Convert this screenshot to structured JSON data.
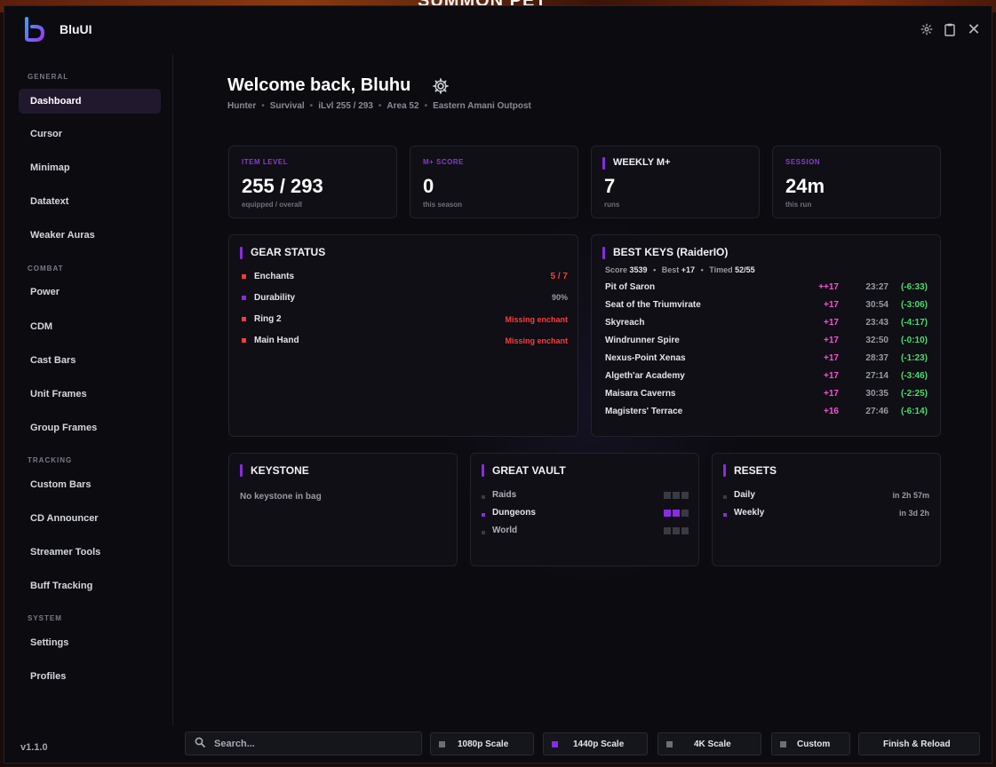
{
  "background": {
    "banner": "SUMMON PET"
  },
  "app": {
    "title": "BluUI",
    "version": "v1.1.0"
  },
  "colors": {
    "accent": "#8a2be2",
    "danger": "#ff3b3b",
    "key_level": "#ff4fd8",
    "time_under": "#4cdc6c"
  },
  "titlebar": {
    "icons": [
      "gear-icon",
      "clipboard-icon",
      "close-icon"
    ]
  },
  "sidebar": {
    "sections": {
      "general": "GENERAL",
      "combat": "COMBAT",
      "tracking": "TRACKING",
      "system": "SYSTEM"
    },
    "items": [
      "Dashboard",
      "Cursor",
      "Minimap",
      "Datatext",
      "Weaker Auras",
      "Power",
      "CDM",
      "Cast Bars",
      "Unit Frames",
      "Group Frames",
      "Custom Bars",
      "CD Announcer",
      "Streamer Tools",
      "Buff Tracking",
      "Settings",
      "Profiles"
    ],
    "active": "Dashboard"
  },
  "header": {
    "welcome": "Welcome back, Bluhu",
    "class": "Hunter",
    "spec": "Survival",
    "ilvl": "iLvl 255 / 293",
    "area": "Area 52",
    "zone": "Eastern Amani Outpost"
  },
  "stats": [
    {
      "label": "ITEM LEVEL",
      "value": "255 / 293",
      "sub": "equipped / overall"
    },
    {
      "label": "M+ SCORE",
      "value": "0",
      "sub": "this season"
    },
    {
      "label": "WEEKLY M+",
      "value": "7",
      "sub": "runs"
    },
    {
      "label": "SESSION",
      "value": "24m",
      "sub": "this run"
    }
  ],
  "gear": {
    "title": "GEAR STATUS",
    "rows": [
      {
        "name": "Enchants",
        "value": "5 / 7"
      },
      {
        "name": "Durability",
        "value": "90%"
      },
      {
        "name": "Ring 2",
        "value": "Missing enchant"
      },
      {
        "name": "Main Hand",
        "value": "Missing enchant"
      }
    ]
  },
  "keys": {
    "title": "BEST KEYS (RaiderIO)",
    "score_label": "Score",
    "score": "3539",
    "best_label": "Best",
    "best": "+17",
    "timed_label": "Timed",
    "timed": "52/55",
    "dungeons": [
      {
        "name": "Pit of Saron",
        "level": "++17",
        "time": "23:27",
        "delta": "(-6:33)"
      },
      {
        "name": "Seat of the Triumvirate",
        "level": "+17",
        "time": "30:54",
        "delta": "(-3:06)"
      },
      {
        "name": "Skyreach",
        "level": "+17",
        "time": "23:43",
        "delta": "(-4:17)"
      },
      {
        "name": "Windrunner Spire",
        "level": "+17",
        "time": "32:50",
        "delta": "(-0:10)"
      },
      {
        "name": "Nexus-Point Xenas",
        "level": "+17",
        "time": "28:37",
        "delta": "(-1:23)"
      },
      {
        "name": "Algeth'ar Academy",
        "level": "+17",
        "time": "27:14",
        "delta": "(-3:46)"
      },
      {
        "name": "Maisara Caverns",
        "level": "+17",
        "time": "30:35",
        "delta": "(-2:25)"
      },
      {
        "name": "Magisters' Terrace",
        "level": "+16",
        "time": "27:46",
        "delta": "(-6:14)"
      }
    ]
  },
  "keystone": {
    "title": "KEYSTONE",
    "text": "No keystone in bag"
  },
  "vault": {
    "title": "GREAT VAULT",
    "rows": [
      {
        "name": "Raids",
        "filled": 0,
        "slots": 3
      },
      {
        "name": "Dungeons",
        "filled": 2,
        "slots": 3
      },
      {
        "name": "World",
        "filled": 0,
        "slots": 3
      }
    ]
  },
  "resets": {
    "title": "RESETS",
    "rows": [
      {
        "name": "Daily",
        "value": "in 2h 57m"
      },
      {
        "name": "Weekly",
        "value": "in 3d 2h"
      }
    ]
  },
  "bottom": {
    "search_placeholder": "Search...",
    "buttons": [
      "1080p Scale",
      "1440p Scale",
      "4K Scale",
      "Custom",
      "Finish & Reload"
    ],
    "active_scale": "1440p Scale"
  }
}
